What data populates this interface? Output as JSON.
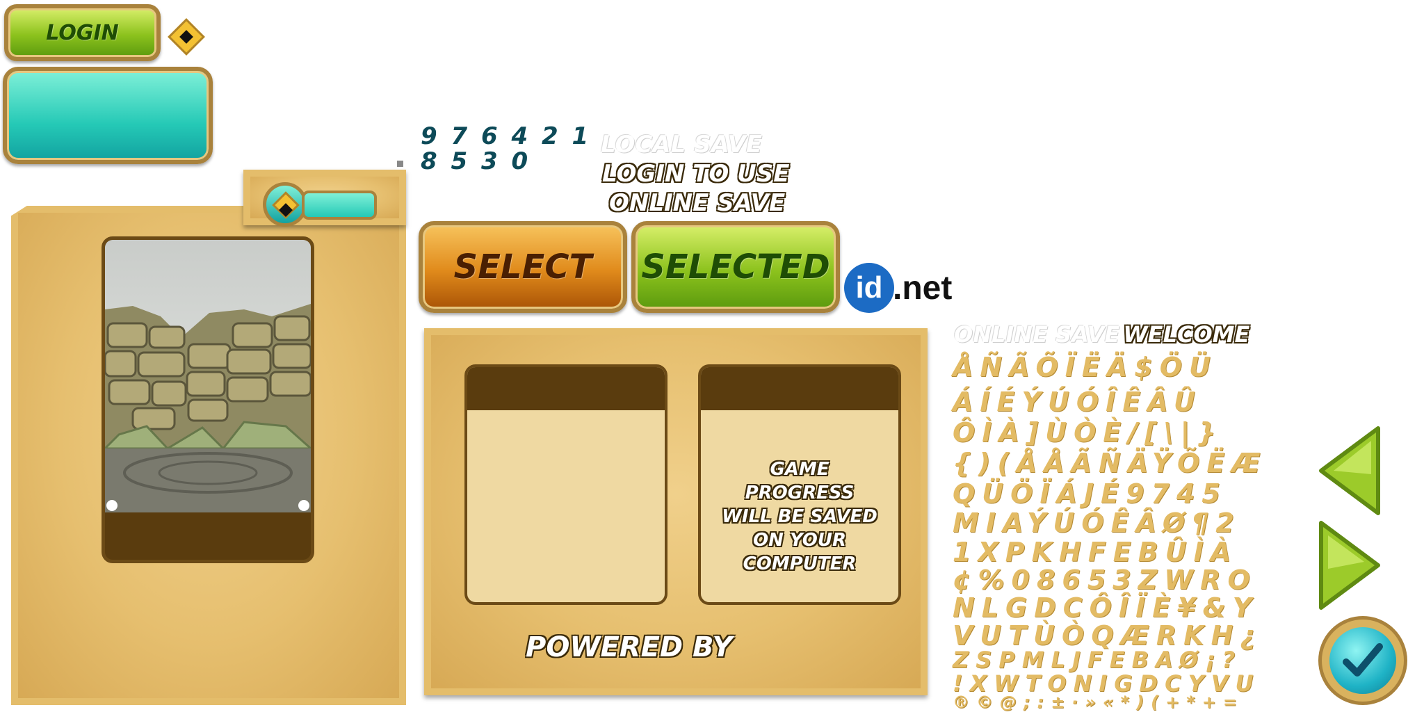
{
  "login_button": {
    "label": "LOGIN"
  },
  "digits": {
    "row1": "9 7 6 4 2 1",
    "row2": "8 5 3 0"
  },
  "labels": {
    "local_save": "LOCAL SAVE",
    "login_to_use": "LOGIN TO USE",
    "online_save": "ONLINE SAVE",
    "online_save_welcome_a": "ONLINE SAVE",
    "online_save_welcome_b": "WELCOME",
    "game_progress": "GAME PROGRESS WILL BE SAVED ON YOUR COMPUTER",
    "powered_by": "POWERED BY"
  },
  "buttons": {
    "select": "SELECT",
    "selected": "SELECTED"
  },
  "brand": {
    "id": "id",
    "net": ".net"
  },
  "glyph_rows": [
    "ÅÑÃÕÏËÄ$ÖÜ",
    "ÁÍÉÝÚÓÎÊÂÛ",
    "ÔÌÀ]ÙÒÈ/[\\|}",
    "{)(ÅÅÃÑÄŸÕËÆ",
    "QÜÖÏÁJÉ9745",
    "MIAÝÚÓÊÂØ¶2",
    "1XPKHFEBÛÌÀ",
    "¢%08653ZWRO",
    "NLGDCÔÎÏÈ¥&Y",
    "VUTÙÒQÆRKH¿",
    "ZSPMLJFEBAØ¡?",
    "!XWTONIGDCYVU",
    "®©@;:±·»«*)(+*+="
  ],
  "colors": {
    "parchment": "#e4bd6b",
    "green": "#8cc21d",
    "orange": "#e08a1b",
    "teal": "#25c9b6",
    "dark_brown": "#5a3c0e",
    "brand_blue": "#1c6bc4"
  },
  "icons": [
    "diamond-icon",
    "arrow-left-icon",
    "arrow-right-icon",
    "checkmark-icon"
  ]
}
